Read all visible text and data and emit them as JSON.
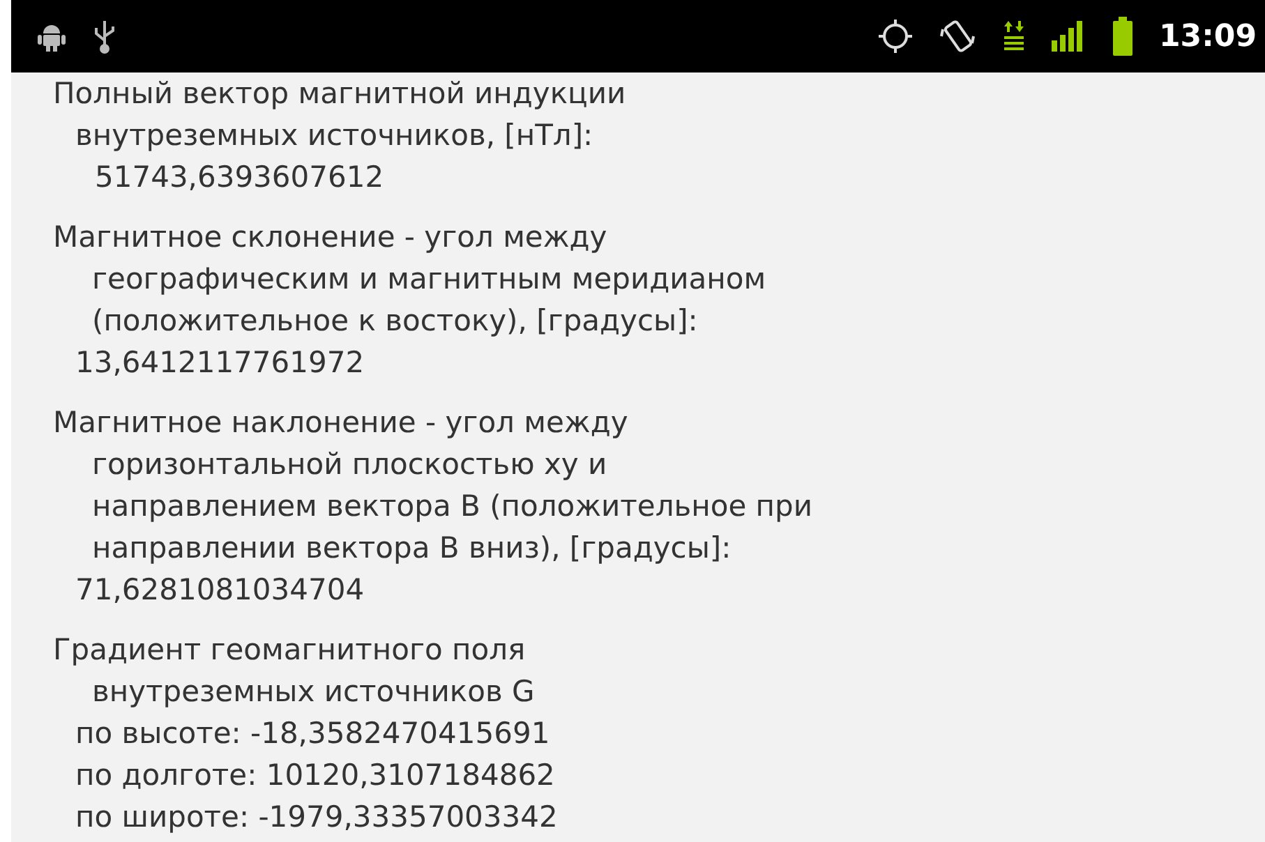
{
  "status_bar": {
    "time": "13:09"
  },
  "blocks": [
    {
      "lines": [
        {
          "kind": "flush",
          "text": "Полный вектор магнитной индукции"
        },
        {
          "kind": "inset",
          "text": "внутреземных источников, [нТл]:"
        },
        {
          "kind": "deep",
          "text": "51743,6393607612"
        }
      ]
    },
    {
      "lines": [
        {
          "kind": "flush",
          "text": "Магнитное склонение - угол между"
        },
        {
          "kind": "wide",
          "text": "географическим и магнитным меридианом"
        },
        {
          "kind": "wide",
          "text": "(положительное к востоку), [градусы]:"
        },
        {
          "kind": "inset",
          "text": "13,6412117761972"
        }
      ]
    },
    {
      "lines": [
        {
          "kind": "flush",
          "text": "Магнитное наклонение - угол между"
        },
        {
          "kind": "wide",
          "text": "горизонтальной плоскостью xy и"
        },
        {
          "kind": "wide",
          "text": "направлением вектора B (положительное при"
        },
        {
          "kind": "wide",
          "text": "направлении вектора B вниз), [градусы]:"
        },
        {
          "kind": "inset",
          "text": "71,6281081034704"
        }
      ]
    },
    {
      "lines": [
        {
          "kind": "flush",
          "text": "Градиент геомагнитного поля"
        },
        {
          "kind": "wide",
          "text": "внутреземных источников G"
        },
        {
          "kind": "inset",
          "text": "по высоте: -18,3582470415691"
        },
        {
          "kind": "inset",
          "text": "по долготе: 10120,3107184862"
        },
        {
          "kind": "inset",
          "text": "по широте: -1979,33357003342"
        }
      ]
    }
  ]
}
